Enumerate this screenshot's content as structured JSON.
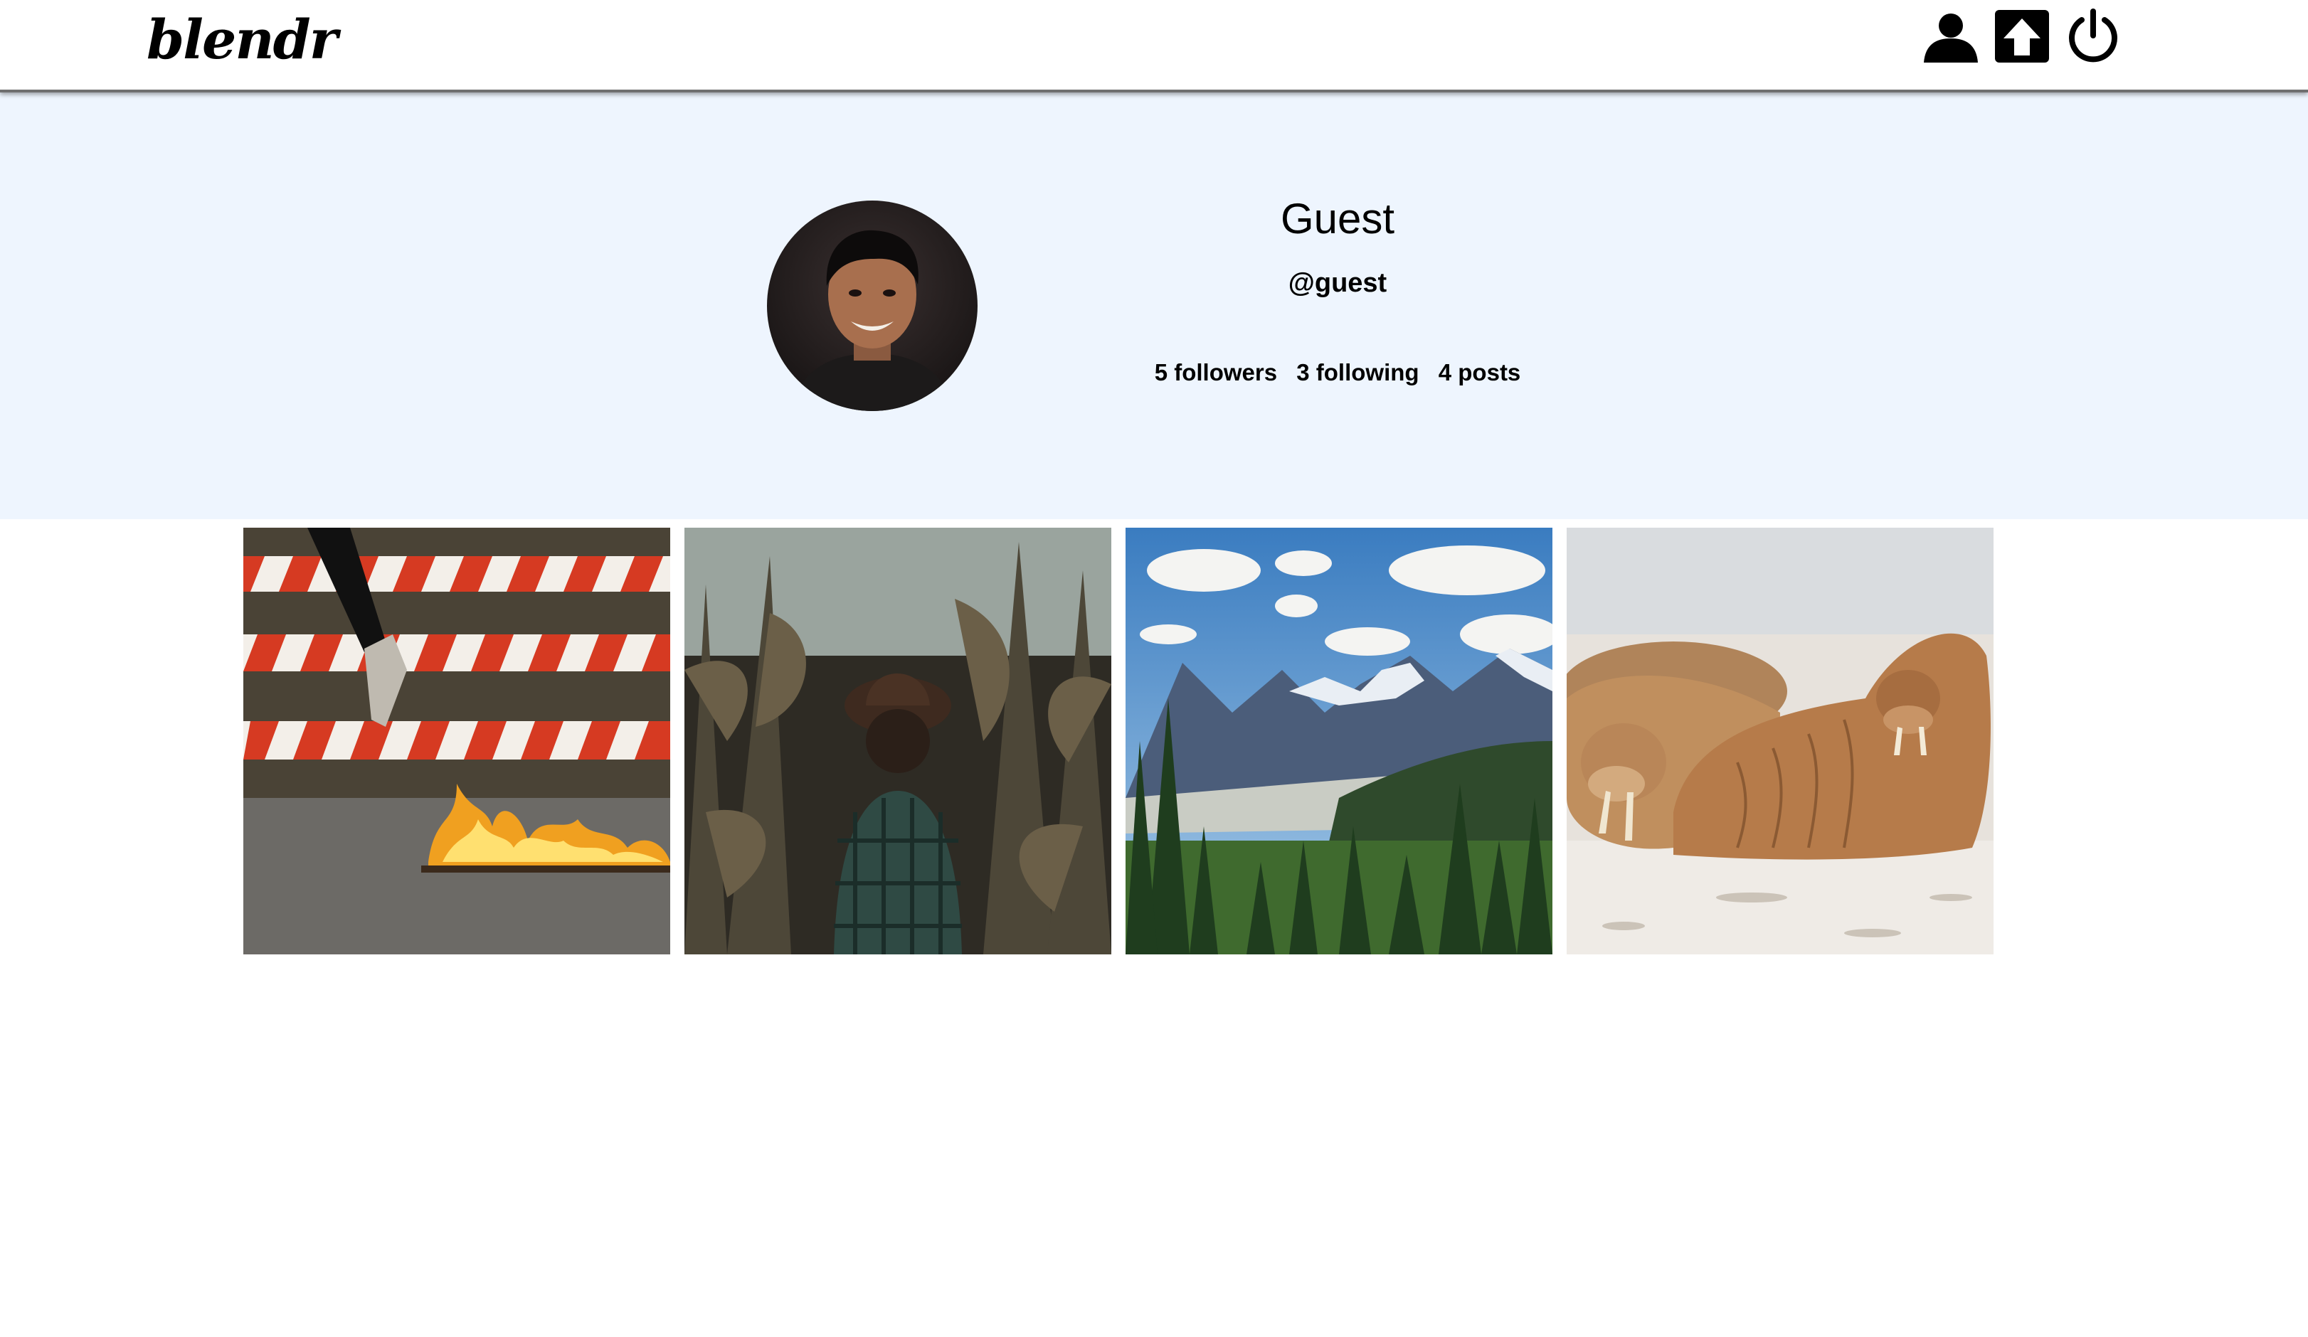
{
  "header": {
    "logo": "blendr",
    "icons": [
      "user-icon",
      "upload-icon",
      "power-icon"
    ]
  },
  "profile": {
    "display_name": "Guest",
    "handle": "@guest",
    "stats": {
      "followers": "5 followers",
      "following": "3 following",
      "posts": "4 posts"
    }
  },
  "posts": [
    {
      "subject": "flaming-sneaker-barricade"
    },
    {
      "subject": "person-in-cornfield"
    },
    {
      "subject": "mountain-valley-forest"
    },
    {
      "subject": "walruses-on-beach"
    }
  ],
  "colors": {
    "banner_bg": "#eef5fe",
    "header_bg": "#ffffff",
    "header_border": "#6f6f6f"
  }
}
